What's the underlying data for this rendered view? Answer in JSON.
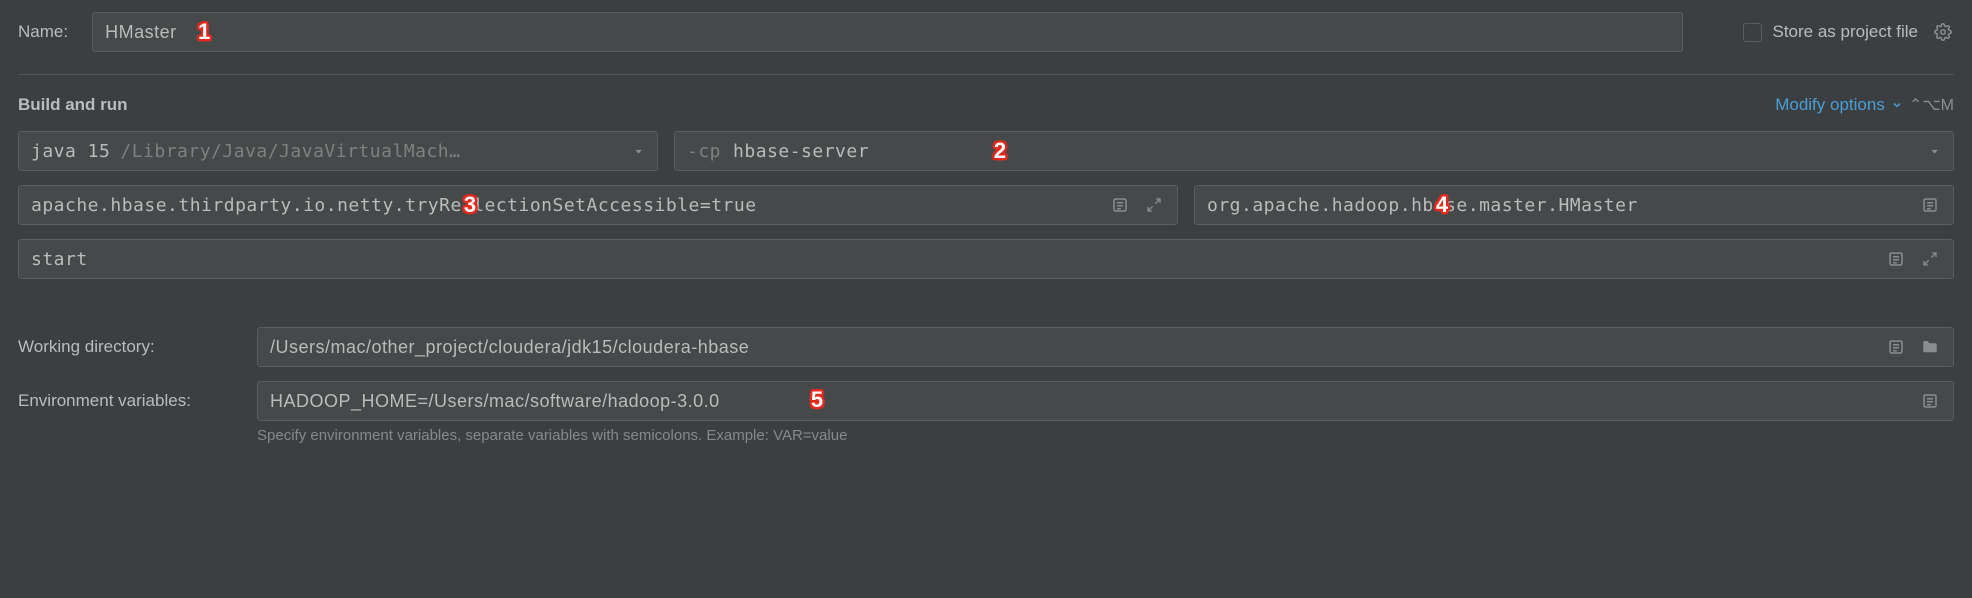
{
  "name_label": "Name:",
  "name_value": "HMaster",
  "store_label": "Store as project file",
  "section_title": "Build and run",
  "modify_options": "Modify options",
  "modify_shortcut": "⌃⌥M",
  "jdk": {
    "prefix": "java 15",
    "path": "/Library/Java/JavaVirtualMach…"
  },
  "classpath": {
    "prefix": "-cp",
    "value": "hbase-server"
  },
  "vm_options": "apache.hbase.thirdparty.io.netty.tryReflectionSetAccessible=true",
  "main_class": "org.apache.hadoop.hbase.master.HMaster",
  "program_args": "start",
  "workdir_label": "Working directory:",
  "workdir_value": "/Users/mac/other_project/cloudera/jdk15/cloudera-hbase",
  "env_label": "Environment variables:",
  "env_value": "HADOOP_HOME=/Users/mac/software/hadoop-3.0.0",
  "env_hint": "Specify environment variables, separate variables with semicolons. Example: VAR=value",
  "markers": {
    "m1": "1",
    "m2": "2",
    "m3": "3",
    "m4": "4",
    "m5": "5"
  }
}
